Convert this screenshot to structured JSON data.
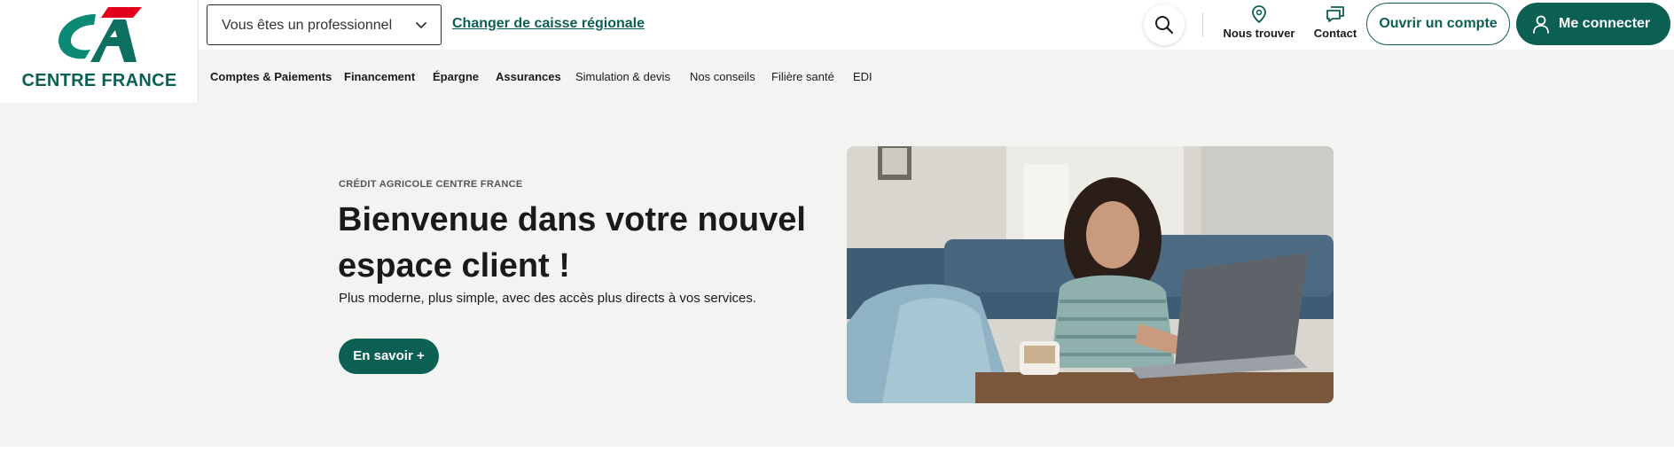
{
  "brand": {
    "name": "CENTRE FRANCE",
    "colors": {
      "primary": "#0c5f53",
      "accent": "#e2001a",
      "hero_bg": "#f3f4f2"
    }
  },
  "header": {
    "profile_select": {
      "value": "Vous êtes un professionnel",
      "icon": "chevron-down-icon"
    },
    "change_region_link": "Changer de caisse régionale",
    "search_icon": "search-icon",
    "find_us": {
      "label": "Nous trouver",
      "icon": "location-pin-icon"
    },
    "contact": {
      "label": "Contact",
      "icon": "chat-icon"
    },
    "open_account": "Ouvrir un compte",
    "login": {
      "label": "Me connecter",
      "icon": "user-icon"
    }
  },
  "nav": {
    "items": [
      {
        "label": "Comptes & Paiements"
      },
      {
        "label": "Financement"
      },
      {
        "label": "Épargne"
      },
      {
        "label": "Assurances"
      },
      {
        "label": "Simulation & devis"
      },
      {
        "label": "Nos conseils"
      },
      {
        "label": "Filière santé"
      },
      {
        "label": "EDI"
      }
    ]
  },
  "hero": {
    "eyebrow": "CRÉDIT AGRICOLE CENTRE FRANCE",
    "title": "Bienvenue dans votre nouvel espace client !",
    "subtitle": "Plus moderne, plus simple, avec des accès plus directs à vos services.",
    "cta": "En savoir +"
  }
}
